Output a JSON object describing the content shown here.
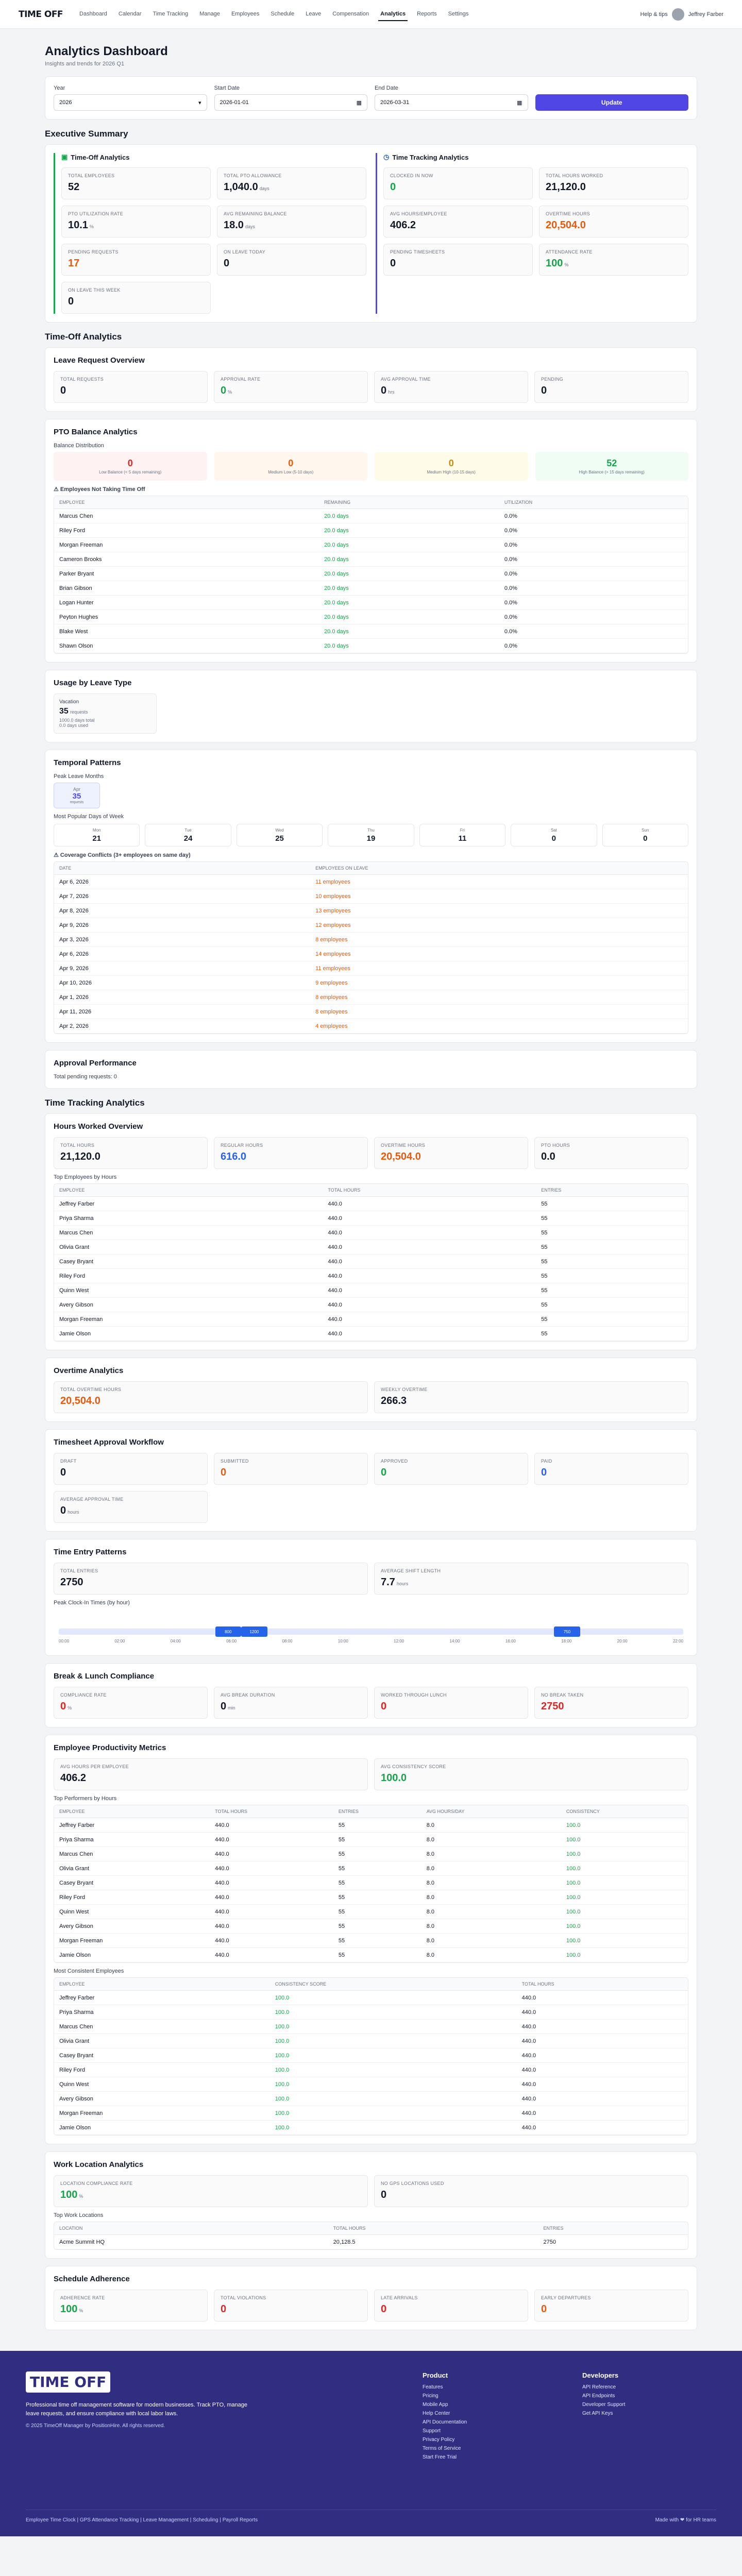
{
  "brand": "TIME OFF",
  "nav": {
    "items": [
      "Dashboard",
      "Calendar",
      "Time Tracking",
      "Manage",
      "Employees",
      "Schedule",
      "Leave",
      "Compensation",
      "Analytics",
      "Reports",
      "Settings"
    ],
    "help": "Help & tips",
    "user": "Jeffrey Farber",
    "active": 8
  },
  "header": {
    "title": "Analytics Dashboard",
    "subtitle": "Insights and trends for 2026 Q1"
  },
  "filters": {
    "year_label": "Year",
    "year": "2026",
    "start_label": "Start Date",
    "start": "2026-01-01",
    "end_label": "End Date",
    "end": "2026-03-31",
    "apply": "Update"
  },
  "exec": {
    "title": "Executive Summary",
    "timeoff": {
      "title": "Time-Off Analytics",
      "stats": [
        {
          "l": "Total Employees",
          "v": "52"
        },
        {
          "l": "Total PTO Allowance",
          "v": "1,040.0",
          "u": "days"
        },
        {
          "l": "PTO Utilization Rate",
          "v": "10.1",
          "u": "%"
        },
        {
          "l": "Avg Remaining Balance",
          "v": "18.0",
          "u": "days"
        },
        {
          "l": "Pending Requests",
          "v": "17"
        },
        {
          "l": "On Leave Today",
          "v": "0"
        },
        {
          "l": "On Leave This Week",
          "v": "0"
        }
      ]
    },
    "tracking": {
      "title": "Time Tracking Analytics",
      "stats": [
        {
          "l": "Clocked In Now",
          "v": "0"
        },
        {
          "l": "Total Hours Worked",
          "v": "21,120.0"
        },
        {
          "l": "Avg Hours/Employee",
          "v": "406.2"
        },
        {
          "l": "Overtime Hours",
          "v": "20,504.0"
        },
        {
          "l": "Pending Timesheets",
          "v": "0"
        },
        {
          "l": "Attendance Rate",
          "v": "100",
          "u": "%"
        }
      ]
    }
  },
  "timeoff_section": "Time-Off Analytics",
  "leave_overview": {
    "title": "Leave Request Overview",
    "stats": [
      {
        "l": "Total Requests",
        "v": "0"
      },
      {
        "l": "Approval Rate",
        "v": "0",
        "u": "%"
      },
      {
        "l": "Avg Approval Time",
        "v": "0",
        "u": "hrs"
      },
      {
        "l": "Pending",
        "v": "0"
      }
    ]
  },
  "pto": {
    "title": "PTO Balance Analytics",
    "dist_label": "Balance Distribution",
    "boxes": [
      {
        "n": "0",
        "t": "Low Balance (< 5 days remaining)"
      },
      {
        "n": "0",
        "t": "Medium Low (5-10 days)"
      },
      {
        "n": "0",
        "t": "Medium High (10-15 days)"
      },
      {
        "n": "52",
        "t": "High Balance (> 15 days remaining)"
      }
    ],
    "link": "Employees Not Taking Time Off",
    "cols": [
      "Employee",
      "Remaining",
      "Utilization"
    ],
    "rows": [
      [
        "Marcus Chen",
        "20.0 days",
        "0.0%"
      ],
      [
        "Riley Ford",
        "20.0 days",
        "0.0%"
      ],
      [
        "Morgan Freeman",
        "20.0 days",
        "0.0%"
      ],
      [
        "Cameron Brooks",
        "20.0 days",
        "0.0%"
      ],
      [
        "Parker Bryant",
        "20.0 days",
        "0.0%"
      ],
      [
        "Brian Gibson",
        "20.0 days",
        "0.0%"
      ],
      [
        "Logan Hunter",
        "20.0 days",
        "0.0%"
      ],
      [
        "Peyton Hughes",
        "20.0 days",
        "0.0%"
      ],
      [
        "Blake West",
        "20.0 days",
        "0.0%"
      ],
      [
        "Shawn Olson",
        "20.0 days",
        "0.0%"
      ]
    ]
  },
  "usage": {
    "title": "Usage by Leave Type",
    "label": "Vacation",
    "count": "35",
    "unit": "requests",
    "detail": "1000.0 days total",
    "detail2": "0.0 days used"
  },
  "temporal": {
    "title": "Temporal Patterns",
    "peak_label": "Peak Leave Months",
    "peak_month": "Apr",
    "peak_count": "35",
    "peak_unit": "requests",
    "days_label": "Most Popular Days of Week",
    "days": [
      {
        "d": "Mon",
        "c": "21"
      },
      {
        "d": "Tue",
        "c": "24"
      },
      {
        "d": "Wed",
        "c": "25"
      },
      {
        "d": "Thu",
        "c": "19"
      },
      {
        "d": "Fri",
        "c": "11"
      },
      {
        "d": "Sat",
        "c": "0"
      },
      {
        "d": "Sun",
        "c": "0"
      }
    ],
    "conflict": "Coverage Conflicts (3+ employees on same day)",
    "cols": [
      "Date",
      "Employees on Leave"
    ],
    "rows": [
      [
        "Apr 6, 2026",
        "11 employees"
      ],
      [
        "Apr 7, 2026",
        "10 employees"
      ],
      [
        "Apr 8, 2026",
        "13 employees"
      ],
      [
        "Apr 9, 2026",
        "12 employees"
      ],
      [
        "Apr 3, 2026",
        "8 employees"
      ],
      [
        "Apr 6, 2026",
        "14 employees"
      ],
      [
        "Apr 9, 2026",
        "11 employees"
      ],
      [
        "Apr 10, 2026",
        "9 employees"
      ],
      [
        "Apr 1, 2026",
        "8 employees"
      ],
      [
        "Apr 11, 2026",
        "8 employees"
      ],
      [
        "Apr 2, 2026",
        "4 employees"
      ]
    ]
  },
  "approval": {
    "title": "Approval Performance",
    "text": "Total pending requests: 0"
  },
  "tracking_section": "Time Tracking Analytics",
  "hours": {
    "title": "Hours Worked Overview",
    "stats": [
      {
        "l": "Total Hours",
        "v": "21,120.0"
      },
      {
        "l": "Regular Hours",
        "v": "616.0"
      },
      {
        "l": "Overtime Hours",
        "v": "20,504.0"
      },
      {
        "l": "PTO Hours",
        "v": "0.0"
      }
    ],
    "top_label": "Top Employees by Hours",
    "cols": [
      "Employee",
      "Total Hours",
      "Entries"
    ],
    "rows": [
      [
        "Jeffrey Farber",
        "440.0",
        "55"
      ],
      [
        "Priya Sharma",
        "440.0",
        "55"
      ],
      [
        "Marcus Chen",
        "440.0",
        "55"
      ],
      [
        "Olivia Grant",
        "440.0",
        "55"
      ],
      [
        "Casey Bryant",
        "440.0",
        "55"
      ],
      [
        "Riley Ford",
        "440.0",
        "55"
      ],
      [
        "Quinn West",
        "440.0",
        "55"
      ],
      [
        "Avery Gibson",
        "440.0",
        "55"
      ],
      [
        "Morgan Freeman",
        "440.0",
        "55"
      ],
      [
        "Jamie Olson",
        "440.0",
        "55"
      ]
    ]
  },
  "overtime": {
    "title": "Overtime Analytics",
    "stats": [
      {
        "l": "Total Overtime Hours",
        "v": "20,504.0"
      },
      {
        "l": "Weekly Overtime",
        "v": "266.3"
      }
    ]
  },
  "timesheet": {
    "title": "Timesheet Approval Workflow",
    "stats": [
      {
        "l": "Draft",
        "v": "0"
      },
      {
        "l": "Submitted",
        "v": "0"
      },
      {
        "l": "Approved",
        "v": "0"
      },
      {
        "l": "Paid",
        "v": "0"
      },
      {
        "l": "Average Approval Time",
        "v": "0",
        "u": "hours"
      }
    ]
  },
  "entry": {
    "title": "Time Entry Patterns",
    "stats": [
      {
        "l": "Total Entries",
        "v": "2750"
      },
      {
        "l": "Average Shift Length",
        "v": "7.7",
        "u": "hours"
      }
    ],
    "clock_label": "Peak Clock-In Times (by hour)",
    "hours": [
      "00:00",
      "02:00",
      "04:00",
      "06:00",
      "08:00",
      "10:00",
      "12:00",
      "14:00",
      "16:00",
      "18:00",
      "20:00",
      "22:00"
    ],
    "peaks": [
      {
        "h": "06:00",
        "c": "800"
      },
      {
        "h": "07:00",
        "c": "1200"
      },
      {
        "h": "19:00",
        "c": "750"
      }
    ]
  },
  "breaks": {
    "title": "Break & Lunch Compliance",
    "stats": [
      {
        "l": "Compliance Rate",
        "v": "0",
        "u": "%"
      },
      {
        "l": "Avg Break Duration",
        "v": "0",
        "u": "min"
      },
      {
        "l": "Worked Through Lunch",
        "v": "0"
      },
      {
        "l": "No Break Taken",
        "v": "2750"
      }
    ]
  },
  "productivity": {
    "title": "Employee Productivity Metrics",
    "stats": [
      {
        "l": "Avg Hours Per Employee",
        "v": "406.2"
      },
      {
        "l": "Avg Consistency Score",
        "v": "100.0"
      }
    ],
    "top_label": "Top Performers by Hours",
    "cols": [
      "Employee",
      "Total Hours",
      "Entries",
      "Avg Hours/Day",
      "Consistency"
    ],
    "rows": [
      [
        "Jeffrey Farber",
        "440.0",
        "55",
        "8.0",
        "100.0"
      ],
      [
        "Priya Sharma",
        "440.0",
        "55",
        "8.0",
        "100.0"
      ],
      [
        "Marcus Chen",
        "440.0",
        "55",
        "8.0",
        "100.0"
      ],
      [
        "Olivia Grant",
        "440.0",
        "55",
        "8.0",
        "100.0"
      ],
      [
        "Casey Bryant",
        "440.0",
        "55",
        "8.0",
        "100.0"
      ],
      [
        "Riley Ford",
        "440.0",
        "55",
        "8.0",
        "100.0"
      ],
      [
        "Quinn West",
        "440.0",
        "55",
        "8.0",
        "100.0"
      ],
      [
        "Avery Gibson",
        "440.0",
        "55",
        "8.0",
        "100.0"
      ],
      [
        "Morgan Freeman",
        "440.0",
        "55",
        "8.0",
        "100.0"
      ],
      [
        "Jamie Olson",
        "440.0",
        "55",
        "8.0",
        "100.0"
      ]
    ],
    "cons_label": "Most Consistent Employees",
    "cols2": [
      "Employee",
      "Consistency Score",
      "Total Hours"
    ],
    "rows2": [
      [
        "Jeffrey Farber",
        "100.0",
        "440.0"
      ],
      [
        "Priya Sharma",
        "100.0",
        "440.0"
      ],
      [
        "Marcus Chen",
        "100.0",
        "440.0"
      ],
      [
        "Olivia Grant",
        "100.0",
        "440.0"
      ],
      [
        "Casey Bryant",
        "100.0",
        "440.0"
      ],
      [
        "Riley Ford",
        "100.0",
        "440.0"
      ],
      [
        "Quinn West",
        "100.0",
        "440.0"
      ],
      [
        "Avery Gibson",
        "100.0",
        "440.0"
      ],
      [
        "Morgan Freeman",
        "100.0",
        "440.0"
      ],
      [
        "Jamie Olson",
        "100.0",
        "440.0"
      ]
    ]
  },
  "location": {
    "title": "Work Location Analytics",
    "stats": [
      {
        "l": "Location Compliance Rate",
        "v": "100",
        "u": "%"
      },
      {
        "l": "No GPS Locations Used",
        "v": "0"
      }
    ],
    "top_label": "Top Work Locations",
    "cols": [
      "Location",
      "Total Hours",
      "Entries"
    ],
    "rows": [
      [
        "Acme Summit HQ",
        "20,128.5",
        "2750"
      ]
    ]
  },
  "schedule": {
    "title": "Schedule Adherence",
    "stats": [
      {
        "l": "Adherence Rate",
        "v": "100",
        "u": "%"
      },
      {
        "l": "Total Violations",
        "v": "0"
      },
      {
        "l": "Late Arrivals",
        "v": "0"
      },
      {
        "l": "Early Departures",
        "v": "0"
      }
    ]
  },
  "footer": {
    "tagline": "Professional time off management software for modern businesses. Track PTO, manage leave requests, and ensure compliance with local labor laws.",
    "copyright": "© 2025 TimeOff Manager by PositionHire. All rights reserved.",
    "product_title": "Product",
    "product": [
      "Features",
      "Pricing",
      "Mobile App",
      "Help Center",
      "API Documentation",
      "Support",
      "Privacy Policy",
      "Terms of Service",
      "Start Free Trial"
    ],
    "dev_title": "Developers",
    "dev": [
      "API Reference",
      "API Endpoints",
      "Developer Support",
      "Get API Keys"
    ],
    "bottom_links": "Employee Time Clock | GPS Attendance Tracking | Leave Management | Scheduling | Payroll Reports",
    "made": "Made with ❤ for HR teams"
  }
}
